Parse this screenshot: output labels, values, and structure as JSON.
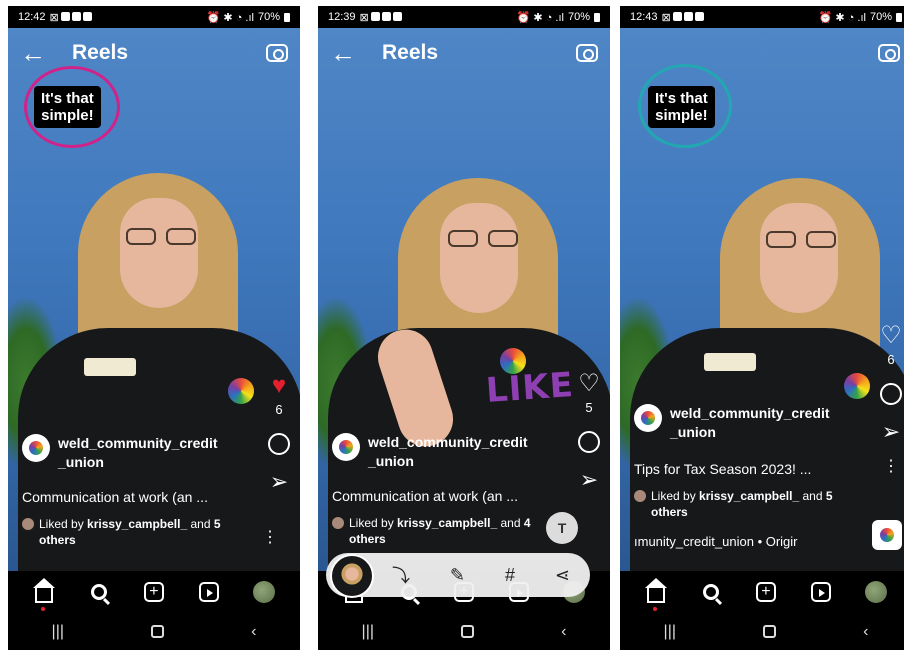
{
  "phones": [
    {
      "status": {
        "time": "12:42",
        "battery": "70%"
      },
      "header": {
        "title": "Reels"
      },
      "sticker": {
        "line1": "It's that",
        "line2": "simple!",
        "ring_color": "#d0238a"
      },
      "rail": {
        "like_count": "6",
        "like_state": "filled"
      },
      "reel": {
        "username_line1": "weld_community_credit",
        "username_line2": "_union",
        "caption": "Communication at work (an ...",
        "liked_by_prefix": "Liked by",
        "liked_by_user": "krissy_campbell_",
        "liked_by_and": "and",
        "liked_by_count": "5",
        "liked_by_suffix": "others"
      }
    },
    {
      "status": {
        "time": "12:39",
        "battery": "70%"
      },
      "header": {
        "title": "Reels"
      },
      "overlay_text": "LIKE",
      "rail": {
        "like_count": "5",
        "like_state": "outline"
      },
      "reel": {
        "username_line1": "weld_community_credit",
        "username_line2": "_union",
        "caption": "Communication at work (an ...",
        "liked_by_prefix": "Liked by",
        "liked_by_user": "krissy_campbell_",
        "liked_by_and": "and",
        "liked_by_count": "4",
        "liked_by_suffix": "others"
      },
      "share_bar": {
        "icons": [
          "scan-icon",
          "edit-crop-icon",
          "hashtag-icon",
          "share-icon"
        ]
      }
    },
    {
      "status": {
        "time": "12:43",
        "battery": "70%"
      },
      "header": {
        "title": ""
      },
      "sticker": {
        "line1": "It's that",
        "line2": "simple!",
        "ring_color": "#23a8b2"
      },
      "rail": {
        "like_count": "6",
        "like_state": "outline"
      },
      "reel": {
        "username_line1": "weld_community_credit",
        "username_line2": "_union",
        "caption": "Tips for Tax Season 2023! ...",
        "liked_by_prefix": "Liked by",
        "liked_by_user": "krissy_campbell_",
        "liked_by_and": "and",
        "liked_by_count": "5",
        "liked_by_suffix": "others",
        "audio": "ımunity_credit_union • Origir"
      }
    }
  ],
  "colors": {
    "like_red": "#e5202e",
    "bg_blue": "#3f78bd",
    "scribble_purple": "#8e3fb2"
  }
}
